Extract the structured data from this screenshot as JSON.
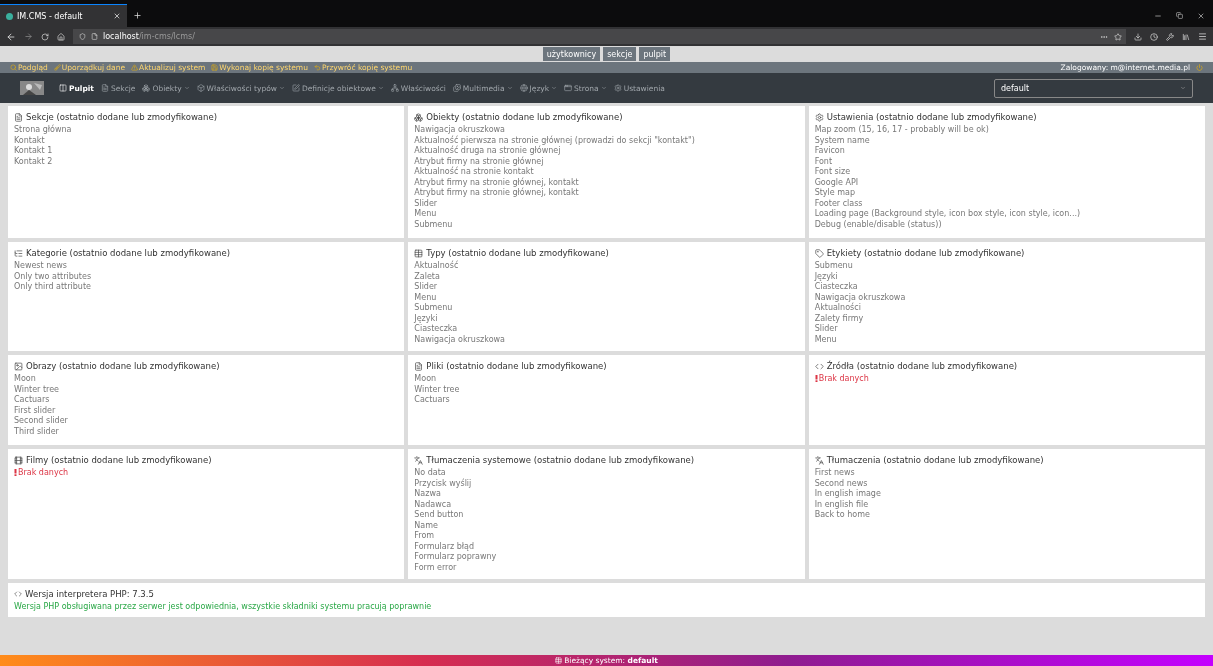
{
  "browser": {
    "tab_title": "IM.CMS - default",
    "url_host": "localhost",
    "url_path": "/im-cms/lcms/"
  },
  "top_buttons": [
    {
      "label": "użytkownicy"
    },
    {
      "label": "sekcje"
    },
    {
      "label": "pulpit"
    }
  ],
  "actions": [
    {
      "label": "Podgląd"
    },
    {
      "label": "Uporządkuj dane"
    },
    {
      "label": "Aktualizuj system"
    },
    {
      "label": "Wykonaj kopię systemu"
    },
    {
      "label": "Przywróć kopię systemu"
    }
  ],
  "logged_in": "Zalogowany: m@internet.media.pl",
  "nav": [
    {
      "label": "Pulpit",
      "dropdown": false,
      "selected": true
    },
    {
      "label": "Sekcje",
      "dropdown": false,
      "selected": false
    },
    {
      "label": "Obiekty",
      "dropdown": true,
      "selected": false
    },
    {
      "label": "Właściwości typów",
      "dropdown": true,
      "selected": false
    },
    {
      "label": "Definicje obiektowe",
      "dropdown": true,
      "selected": false
    },
    {
      "label": "Właściwości",
      "dropdown": false,
      "selected": false
    },
    {
      "label": "Multimedia",
      "dropdown": true,
      "selected": false
    },
    {
      "label": "Język",
      "dropdown": true,
      "selected": false
    },
    {
      "label": "Strona",
      "dropdown": true,
      "selected": false
    },
    {
      "label": "Ustawienia",
      "dropdown": false,
      "selected": false
    }
  ],
  "system_select": {
    "value": "default"
  },
  "cards": [
    {
      "title": "Sekcje (ostatnio dodane lub zmodyfikowane)",
      "items": [
        "Strona główna",
        "Kontakt",
        "Kontakt 1",
        "Kontakt 2"
      ]
    },
    {
      "title": "Obiekty (ostatnio dodane lub zmodyfikowane)",
      "items": [
        "Nawigacja okruszkowa",
        "Aktualność pierwsza na stronie głównej (prowadzi do sekcji \"kontakt\")",
        "Aktualność druga na stronie głównej",
        "Atrybut firmy na stronie głównej",
        "Aktualność na stronie kontakt",
        "Atrybut firmy na stronie głównej, kontakt",
        "Atrybut firmy na stronie głównej, kontakt",
        "Slider",
        "Menu",
        "Submenu"
      ]
    },
    {
      "title": "Ustawienia (ostatnio dodane lub zmodyfikowane)",
      "items": [
        "Map zoom (15, 16, 17 - probably will be ok)",
        "System name",
        "Favicon",
        "Font",
        "Font size",
        "Google API",
        "Style map",
        "Footer class",
        "Loading page (Background style, icon box style, icon style, icon...)",
        "Debug (enable/disable (status))"
      ]
    },
    {
      "title": "Kategorie (ostatnio dodane lub zmodyfikowane)",
      "items": [
        "Newest news",
        "Only two attributes",
        "Only third attribute"
      ]
    },
    {
      "title": "Typy (ostatnio dodane lub zmodyfikowane)",
      "items": [
        "Aktualność",
        "Zaleta",
        "Slider",
        "Menu",
        "Submenu",
        "Języki",
        "Ciasteczka",
        "Nawigacja okruszkowa"
      ]
    },
    {
      "title": "Etykiety (ostatnio dodane lub zmodyfikowane)",
      "items": [
        "Submenu",
        "Języki",
        "Ciasteczka",
        "Nawigacja okruszkowa",
        "Aktualności",
        "Zalety firmy",
        "Slider",
        "Menu"
      ]
    },
    {
      "title": "Obrazy (ostatnio dodane lub zmodyfikowane)",
      "items": [
        "Moon",
        "Winter tree",
        "Cactuars",
        "First slider",
        "Second slider",
        "Third slider"
      ]
    },
    {
      "title": "Pliki (ostatnio dodane lub zmodyfikowane)",
      "items": [
        "Moon",
        "Winter tree",
        "Cactuars"
      ]
    },
    {
      "title": "Źródła (ostatnio dodane lub zmodyfikowane)",
      "empty": "Brak danych"
    },
    {
      "title": "Filmy (ostatnio dodane lub zmodyfikowane)",
      "empty": "Brak danych"
    },
    {
      "title": "Tłumaczenia systemowe (ostatnio dodane lub zmodyfikowane)",
      "items": [
        "No data",
        "Przycisk wyślij",
        "Nazwa",
        "Nadawca",
        "Send button",
        "Name",
        "From",
        "Formularz błąd",
        "Formularz poprawny",
        "Form error"
      ]
    },
    {
      "title": "Tłumaczenia (ostatnio dodane lub zmodyfikowane)",
      "items": [
        "First news",
        "Second news",
        "In english image",
        "In english file",
        "Back to home"
      ]
    }
  ],
  "php": {
    "title": "Wersja interpretera PHP: 7.3.5",
    "message": "Wersja PHP obsługiwana przez serwer jest odpowiednia, wszystkie składniki systemu pracują poprawnie"
  },
  "footer": "Bieżący system: **default**"
}
